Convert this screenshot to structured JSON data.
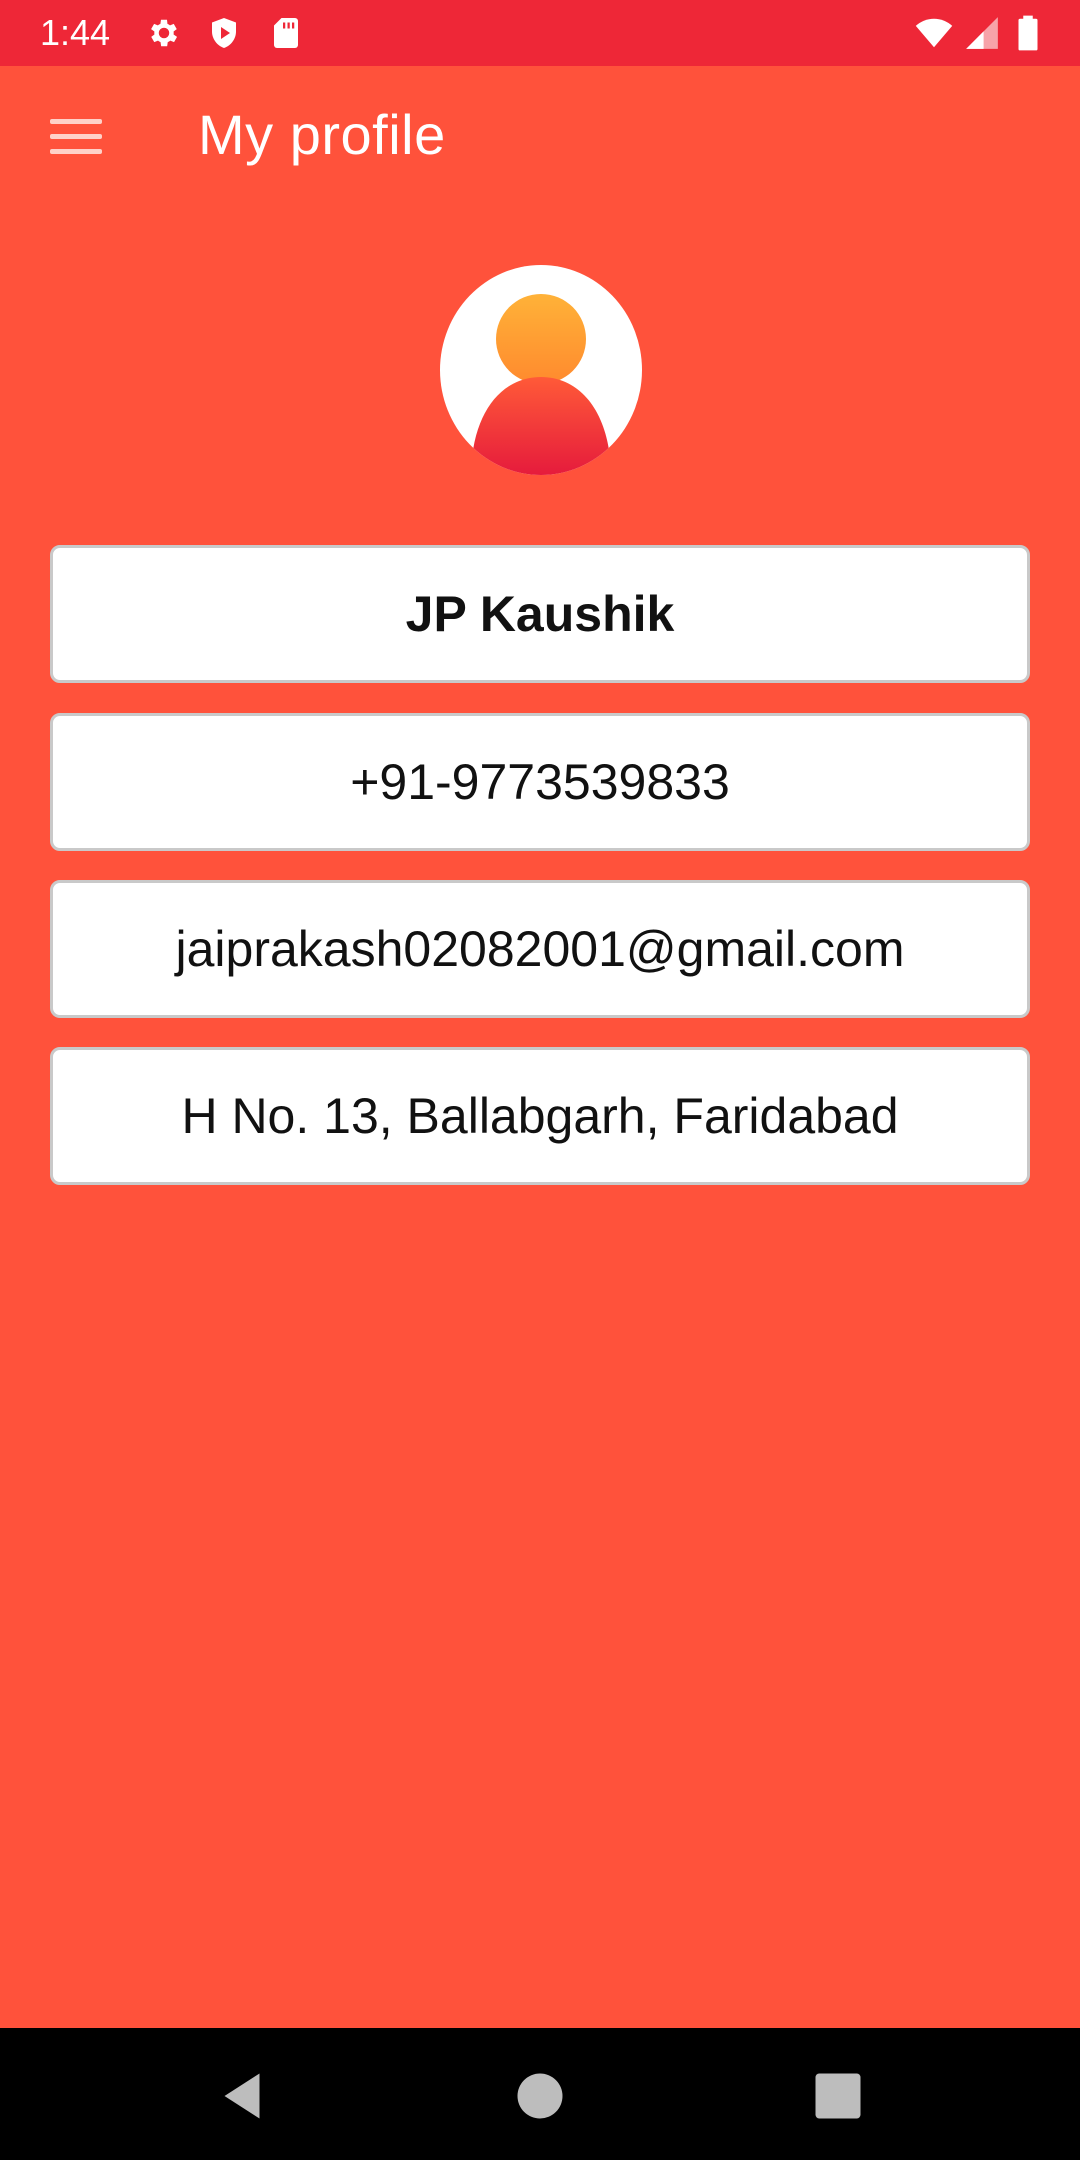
{
  "status_bar": {
    "time": "1:44",
    "left_icons": [
      "gear-icon",
      "shield-icon",
      "sd-card-icon"
    ],
    "right_icons": [
      "wifi-icon",
      "signal-icon",
      "battery-icon"
    ]
  },
  "app_bar": {
    "menu_icon": "hamburger-menu-icon",
    "title": "My profile"
  },
  "profile": {
    "avatar_icon": "person-avatar-icon",
    "name": "JP Kaushik",
    "phone": "+91-9773539833",
    "email": "jaiprakash02082001@gmail.com",
    "address": "H No. 13, Ballabgarh, Faridabad"
  },
  "nav_bar": {
    "buttons": [
      "back-icon",
      "home-icon",
      "recents-icon"
    ]
  },
  "colors": {
    "status_bar": "#EE2737",
    "background": "#FF523B",
    "field_border": "#C9C9C9",
    "avatar_head": "#FFA93A",
    "avatar_body": "#F0283B"
  }
}
